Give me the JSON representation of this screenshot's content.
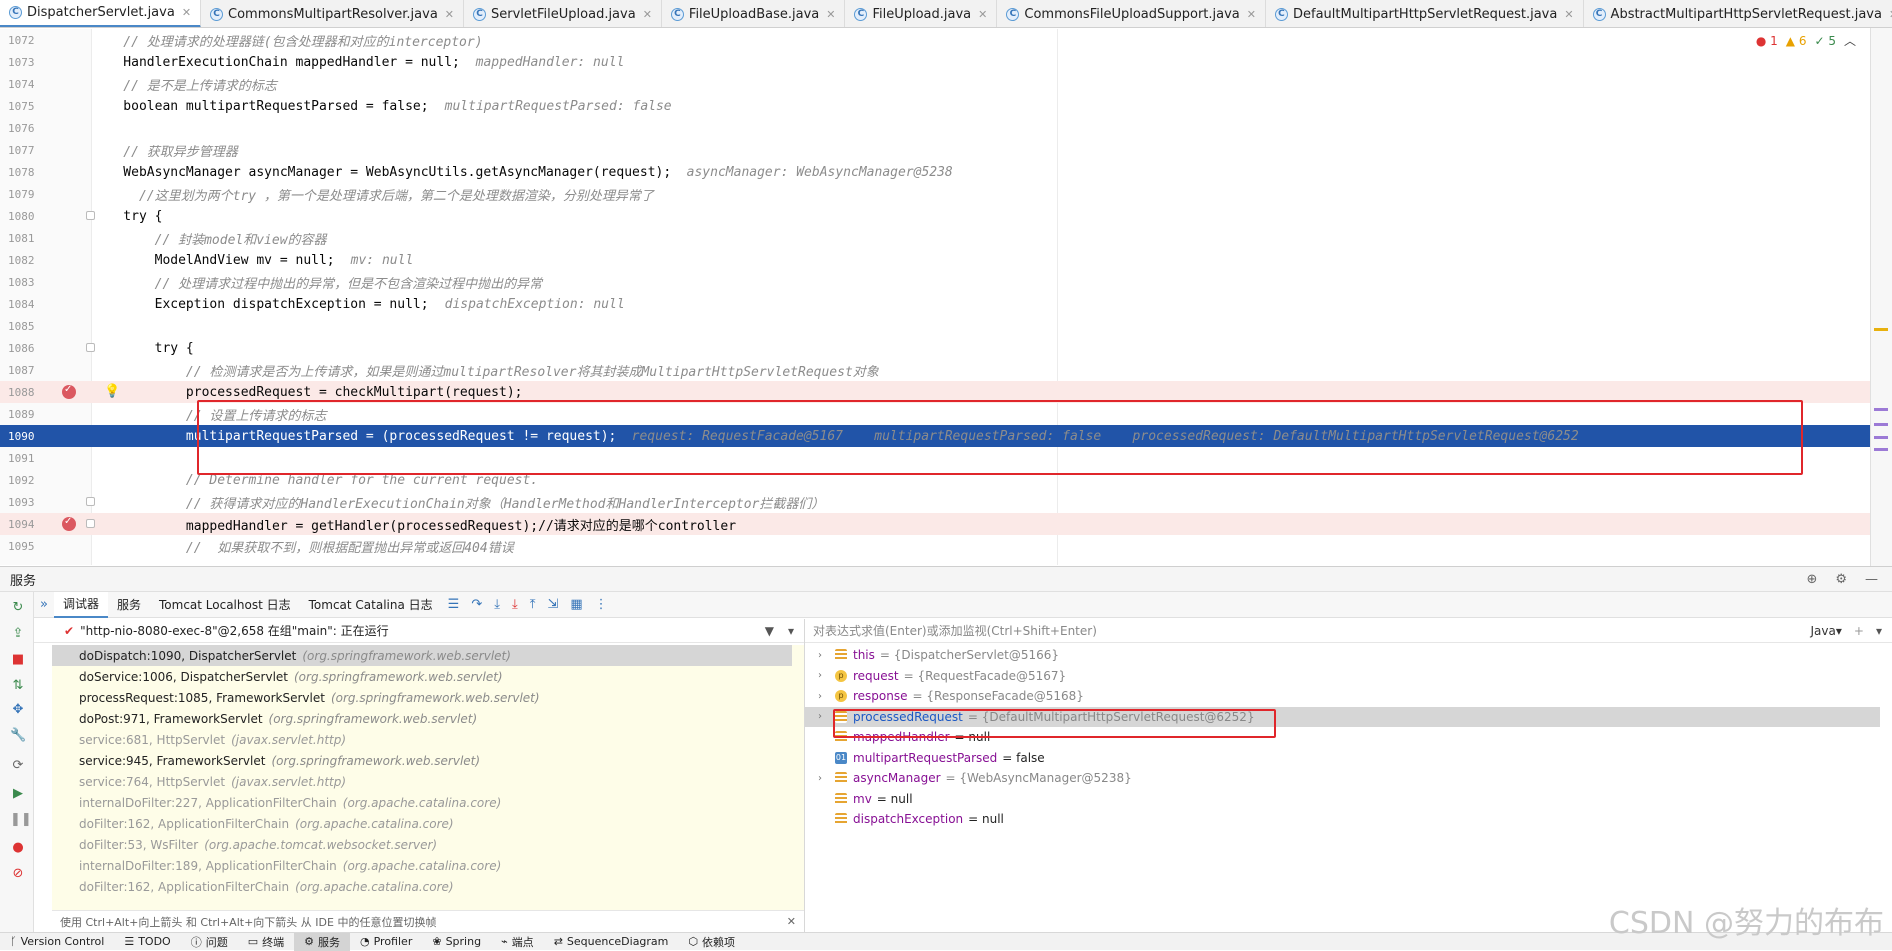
{
  "tabs": [
    {
      "label": "DispatcherServlet.java",
      "icon": "class-icon",
      "active": true
    },
    {
      "label": "CommonsMultipartResolver.java",
      "icon": "class-icon"
    },
    {
      "label": "ServletFileUpload.java",
      "icon": "class-icon"
    },
    {
      "label": "FileUploadBase.java",
      "icon": "class-icon"
    },
    {
      "label": "FileUpload.java",
      "icon": "class-icon"
    },
    {
      "label": "CommonsFileUploadSupport.java",
      "icon": "class-icon"
    },
    {
      "label": "DefaultMultipartHttpServletRequest.java",
      "icon": "class-icon"
    },
    {
      "label": "AbstractMultipartHttpServletRequest.java",
      "icon": "class-icon"
    },
    {
      "label": "MultipartHttpS",
      "icon": "interface-icon"
    }
  ],
  "inspections": {
    "errors": "1",
    "warnings": "6",
    "ok": "5"
  },
  "code_lines": [
    {
      "num": "1072",
      "text": "    // 处理请求的处理器链(包含处理器和对应的interceptor)",
      "kind": "comment"
    },
    {
      "num": "1073",
      "text": "    HandlerExecutionChain mappedHandler = null;",
      "hint": "  mappedHandler: null"
    },
    {
      "num": "1074",
      "text": "    // 是不是上传请求的标志",
      "kind": "comment"
    },
    {
      "num": "1075",
      "text": "    boolean multipartRequestParsed = false;",
      "hint": "  multipartRequestParsed: false"
    },
    {
      "num": "1076",
      "text": ""
    },
    {
      "num": "1077",
      "text": "    // 获取异步管理器",
      "kind": "comment"
    },
    {
      "num": "1078",
      "text": "    WebAsyncManager asyncManager = WebAsyncUtils.getAsyncManager(request);",
      "hint": "  asyncManager: WebAsyncManager@5238"
    },
    {
      "num": "1079",
      "text": "      //这里划为两个try ，第一个是处理请求后端，第二个是处理数据渲染，分别处理异常了",
      "kind": "comment"
    },
    {
      "num": "1080",
      "text": "    try {"
    },
    {
      "num": "1081",
      "text": "        // 封装model和view的容器",
      "kind": "comment"
    },
    {
      "num": "1082",
      "text": "        ModelAndView mv = null;",
      "hint": "  mv: null"
    },
    {
      "num": "1083",
      "text": "        // 处理请求过程中抛出的异常，但是不包含渲染过程中抛出的异常",
      "kind": "comment"
    },
    {
      "num": "1084",
      "text": "        Exception dispatchException = null;",
      "hint": "  dispatchException: null"
    },
    {
      "num": "1085",
      "text": ""
    },
    {
      "num": "1086",
      "text": "        try {"
    },
    {
      "num": "1087",
      "text": "            // 检测请求是否为上传请求，如果是则通过multipartResolver将其封装成MultipartHttpServletRequest对象",
      "kind": "comment"
    },
    {
      "num": "1088",
      "text": "            processedRequest = checkMultipart(request);",
      "hl": "red"
    },
    {
      "num": "1089",
      "text": "            // 设置上传请求的标志",
      "kind": "comment"
    },
    {
      "num": "1090",
      "text": "            multipartRequestParsed = (processedRequest != request);",
      "hint": "  request: RequestFacade@5167    multipartRequestParsed: false    processedRequest: DefaultMultipartHttpServletRequest@6252",
      "hl": "blue"
    },
    {
      "num": "1091",
      "text": ""
    },
    {
      "num": "1092",
      "text": "            // Determine handler for the current request.",
      "kind": "comment"
    },
    {
      "num": "1093",
      "text": "            // 获得请求对应的HandlerExecutionChain对象（HandlerMethod和HandlerInterceptor拦截器们）",
      "kind": "comment"
    },
    {
      "num": "1094",
      "text": "            mappedHandler = getHandler(processedRequest);//请求对应的是哪个controller",
      "hl": "red"
    },
    {
      "num": "1095",
      "text": "            //  如果获取不到，则根据配置抛出异常或返回404错误",
      "kind": "comment"
    }
  ],
  "services": {
    "title": "服务",
    "subtabs": [
      "调试器",
      "服务",
      "Tomcat Localhost 日志",
      "Tomcat Catalina 日志"
    ],
    "thread": "\"http-nio-8080-exec-8\"@2,658 在组\"main\": 正在运行",
    "frames": [
      {
        "m": "doDispatch:1090, DispatcherServlet",
        "p": "(org.springframework.web.servlet)",
        "sel": true
      },
      {
        "m": "doService:1006, DispatcherServlet",
        "p": "(org.springframework.web.servlet)"
      },
      {
        "m": "processRequest:1085, FrameworkServlet",
        "p": "(org.springframework.web.servlet)"
      },
      {
        "m": "doPost:971, FrameworkServlet",
        "p": "(org.springframework.web.servlet)"
      },
      {
        "m": "service:681, HttpServlet",
        "p": "(javax.servlet.http)",
        "lib": true
      },
      {
        "m": "service:945, FrameworkServlet",
        "p": "(org.springframework.web.servlet)"
      },
      {
        "m": "service:764, HttpServlet",
        "p": "(javax.servlet.http)",
        "lib": true
      },
      {
        "m": "internalDoFilter:227, ApplicationFilterChain",
        "p": "(org.apache.catalina.core)",
        "lib": true
      },
      {
        "m": "doFilter:162, ApplicationFilterChain",
        "p": "(org.apache.catalina.core)",
        "lib": true
      },
      {
        "m": "doFilter:53, WsFilter",
        "p": "(org.apache.tomcat.websocket.server)",
        "lib": true
      },
      {
        "m": "internalDoFilter:189, ApplicationFilterChain",
        "p": "(org.apache.catalina.core)",
        "lib": true
      },
      {
        "m": "doFilter:162, ApplicationFilterChain",
        "p": "(org.apache.catalina.core)",
        "lib": true
      }
    ],
    "frames_hint": "使用 Ctrl+Alt+向上箭头 和 Ctrl+Alt+向下箭头 从 IDE 中的任意位置切换帧",
    "eval_placeholder": "对表达式求值(Enter)或添加监视(Ctrl+Shift+Enter)",
    "lang": "Java",
    "variables": [
      {
        "name": "this",
        "value": "= {DispatcherServlet@5166}",
        "icon": "f",
        "expand": true
      },
      {
        "name": "request",
        "value": "= {RequestFacade@5167}",
        "icon": "p",
        "expand": true
      },
      {
        "name": "response",
        "value": "= {ResponseFacade@5168}",
        "icon": "p",
        "expand": true
      },
      {
        "name": "processedRequest",
        "value": "= {DefaultMultipartHttpServletRequest@6252}",
        "icon": "f",
        "expand": true,
        "sel": true
      },
      {
        "name": "mappedHandler",
        "value": "= null",
        "icon": "f"
      },
      {
        "name": "multipartRequestParsed",
        "value": "= false",
        "icon": "b",
        "badge": "01"
      },
      {
        "name": "asyncManager",
        "value": "= {WebAsyncManager@5238}",
        "icon": "f",
        "expand": true
      },
      {
        "name": "mv",
        "value": "= null",
        "icon": "f"
      },
      {
        "name": "dispatchException",
        "value": "= null",
        "icon": "f"
      }
    ]
  },
  "statusbar": [
    "Version Control",
    "TODO",
    "问题",
    "终端",
    "服务",
    "Profiler",
    "Spring",
    "端点",
    "SequenceDiagram",
    "依赖项"
  ],
  "watermark": "CSDN @努力的布布"
}
